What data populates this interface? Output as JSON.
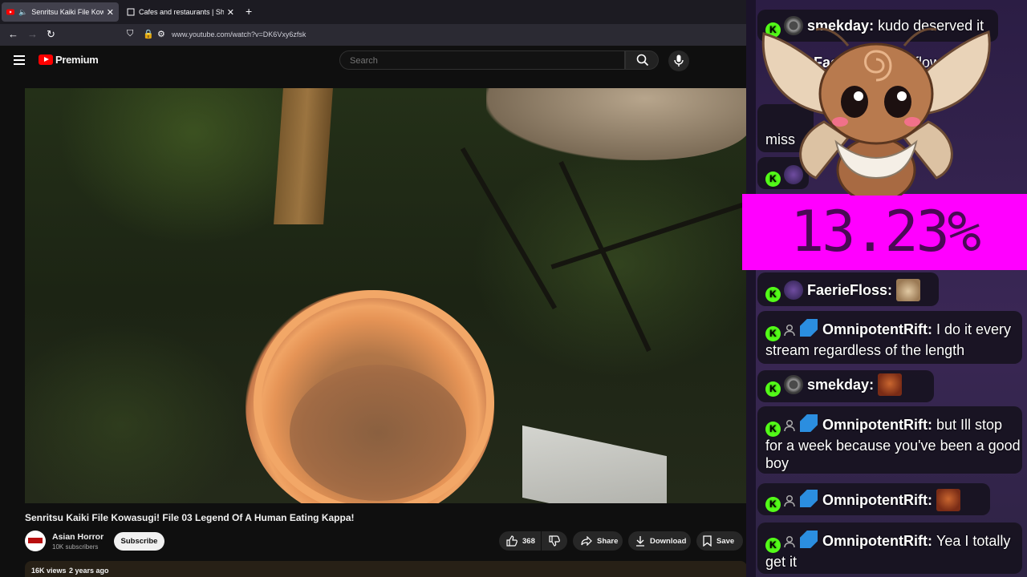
{
  "browser": {
    "tabs": [
      {
        "title": "Senritsu Kaiki File Kowasugi",
        "active": true
      },
      {
        "title": "Cafes and restaurants | Shops |",
        "active": false
      }
    ],
    "url": "www.youtube.com/watch?v=DK6Vxy6zfsk"
  },
  "youtube": {
    "brand": "Premium",
    "search_placeholder": "Search",
    "video": {
      "title": "Senritsu Kaiki File Kowasugi! File 03 Legend Of A Human Eating Kappa!",
      "channel": "Asian Horror",
      "subscribers": "10K subscribers",
      "subscribe_label": "Subscribe",
      "likes": "368",
      "share_label": "Share",
      "download_label": "Download",
      "save_label": "Save",
      "views": "16K views",
      "age": "2 years ago"
    }
  },
  "overlay": {
    "percentage": "13.23%",
    "chat": [
      {
        "user": "smekday",
        "text": "kudo deserved it"
      },
      {
        "user": "FaerieFloss",
        "text": "a flow"
      },
      {
        "user": "",
        "text": "miss"
      },
      {
        "user": "FaerieFloss",
        "text": "",
        "emote": "cat-emote"
      },
      {
        "user": "OmnipotentRift",
        "text": "I do it every stream regardless of the length"
      },
      {
        "user": "smekday",
        "text": "",
        "emote": "face-emote"
      },
      {
        "user": "OmnipotentRift",
        "text": "but Ill stop for a week because you've been a good boy"
      },
      {
        "user": "OmnipotentRift",
        "text": "",
        "emote": "face-emote"
      },
      {
        "user": "OmnipotentRift",
        "text": "Yea I totally get it"
      }
    ]
  }
}
